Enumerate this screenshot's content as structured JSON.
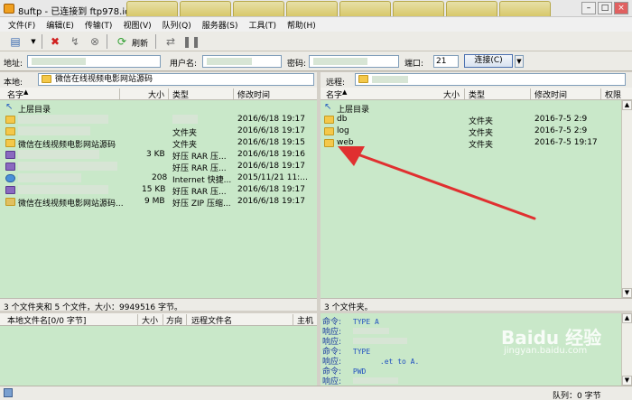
{
  "window": {
    "title": "8uftp - 已连接到 ftp978.idcug.com"
  },
  "menu": [
    "文件(F)",
    "编辑(E)",
    "传输(T)",
    "视图(V)",
    "队列(Q)",
    "服务器(S)",
    "工具(T)",
    "帮助(H)"
  ],
  "toolbar": {
    "refresh_label": "刷新"
  },
  "connection": {
    "address_label": "地址:",
    "username_label": "用户名:",
    "password_label": "密码:",
    "port_label": "端口:",
    "port_value": "21",
    "connect_label": "连接(C)"
  },
  "local": {
    "path_label": "本地:",
    "path_value": "微信在线视频电影网站源码",
    "columns": {
      "name": "名字",
      "size": "大小",
      "type": "类型",
      "modified": "修改时间"
    },
    "rows": [
      {
        "name": "上层目录",
        "size": "",
        "type": "",
        "modified": "",
        "icon": "up-dir"
      },
      {
        "name": "",
        "size": "",
        "type": "",
        "modified": "2016/6/18 19:17",
        "icon": "folder"
      },
      {
        "name": "",
        "size": "",
        "type": "文件夹",
        "modified": "2016/6/18 19:17",
        "icon": "folder"
      },
      {
        "name": "微信在线视频电影网站源码",
        "size": "",
        "type": "文件夹",
        "modified": "2016/6/18 19:15",
        "icon": "folder"
      },
      {
        "name": "",
        "size": "3 KB",
        "type": "好压 RAR 压...",
        "modified": "2016/6/18 19:16",
        "icon": "rar"
      },
      {
        "name": "",
        "size": "",
        "type": "好压 RAR 压...",
        "modified": "2016/6/18 19:17",
        "icon": "rar"
      },
      {
        "name": "",
        "size": "208",
        "type": "Internet 快捷...",
        "modified": "2015/11/21 11:...",
        "icon": "ie"
      },
      {
        "name": "",
        "size": "15 KB",
        "type": "好压 RAR 压...",
        "modified": "2016/6/18 19:17",
        "icon": "rar"
      },
      {
        "name": "微信在线视频电影网站源码...",
        "size": "9 MB",
        "type": "好压 ZIP 压缩...",
        "modified": "2016/6/18 19:17",
        "icon": "zip"
      }
    ],
    "status": "3 个文件夹和 5 个文件，大小：9949516 字节。"
  },
  "remote": {
    "path_label": "远程:",
    "columns": {
      "name": "名字",
      "size": "大小",
      "type": "类型",
      "modified": "修改时间",
      "perm": "权限"
    },
    "rows": [
      {
        "name": "上层目录",
        "type": "",
        "modified": "",
        "icon": "up-dir"
      },
      {
        "name": "db",
        "type": "文件夹",
        "modified": "2016-7-5 2:9",
        "icon": "folder"
      },
      {
        "name": "log",
        "type": "文件夹",
        "modified": "2016-7-5 2:9",
        "icon": "folder"
      },
      {
        "name": "web",
        "type": "文件夹",
        "modified": "2016-7-5 19:17",
        "icon": "folder"
      }
    ],
    "status": "3 个文件夹。"
  },
  "queue": {
    "columns": {
      "local_file": "本地文件名[0/0 字节]",
      "size": "大小",
      "direction": "方向",
      "remote_file": "远程文件名",
      "host": "主机"
    }
  },
  "log": [
    {
      "key": "命令:",
      "value": "TYPE A"
    },
    {
      "key": "响应:",
      "value": ""
    },
    {
      "key": "响应:",
      "value": ""
    },
    {
      "key": "命令:",
      "value": "TYPE"
    },
    {
      "key": "响应:",
      "value": ".et to A."
    },
    {
      "key": "命令:",
      "value": "PWD"
    },
    {
      "key": "响应:",
      "value": ""
    }
  ],
  "statusbar": {
    "queue": "队列：0 字节"
  },
  "watermark": {
    "brand": "Baidu 经验",
    "url": "jingyan.baidu.com"
  },
  "colors": {
    "pane_bg": "#c9e8c9",
    "arrow": "#e03030"
  }
}
